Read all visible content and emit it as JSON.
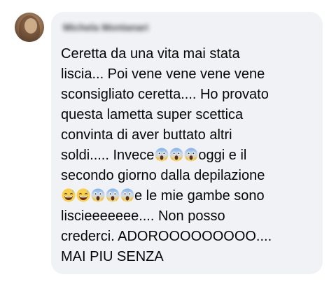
{
  "comment": {
    "author": "Michela Montanari",
    "lines": [
      [
        {
          "t": "Ceretta da una vita mai stata"
        }
      ],
      [
        {
          "t": "liscia... Poi vene vene vene vene"
        }
      ],
      [
        {
          "t": "sconsigliato ceretta.... Ho provato"
        }
      ],
      [
        {
          "t": "questa lametta super scettica"
        }
      ],
      [
        {
          "t": "convinta di aver buttato altri"
        }
      ],
      [
        {
          "t": "soldi..... Invece"
        },
        {
          "e": "scream"
        },
        {
          "e": "scream"
        },
        {
          "e": "scream"
        },
        {
          "t": "oggi e il"
        }
      ],
      [
        {
          "t": "secondo giorno dalla depilazione"
        }
      ],
      [
        {
          "e": "grin-sweat"
        },
        {
          "e": "grin-sweat"
        },
        {
          "e": "scream"
        },
        {
          "e": "scream"
        },
        {
          "e": "scream"
        },
        {
          "t": "e le mie gambe sono"
        }
      ],
      [
        {
          "t": "liscieeeeeee.... Non posso"
        }
      ],
      [
        {
          "t": "crederci. ADOROOOOOOOOO...."
        }
      ],
      [
        {
          "t": "MAI PIU SENZA"
        }
      ]
    ]
  },
  "emoji_names": {
    "scream": "face-screaming-in-fear-emoji",
    "grin-sweat": "grinning-face-with-sweat-emoji"
  }
}
